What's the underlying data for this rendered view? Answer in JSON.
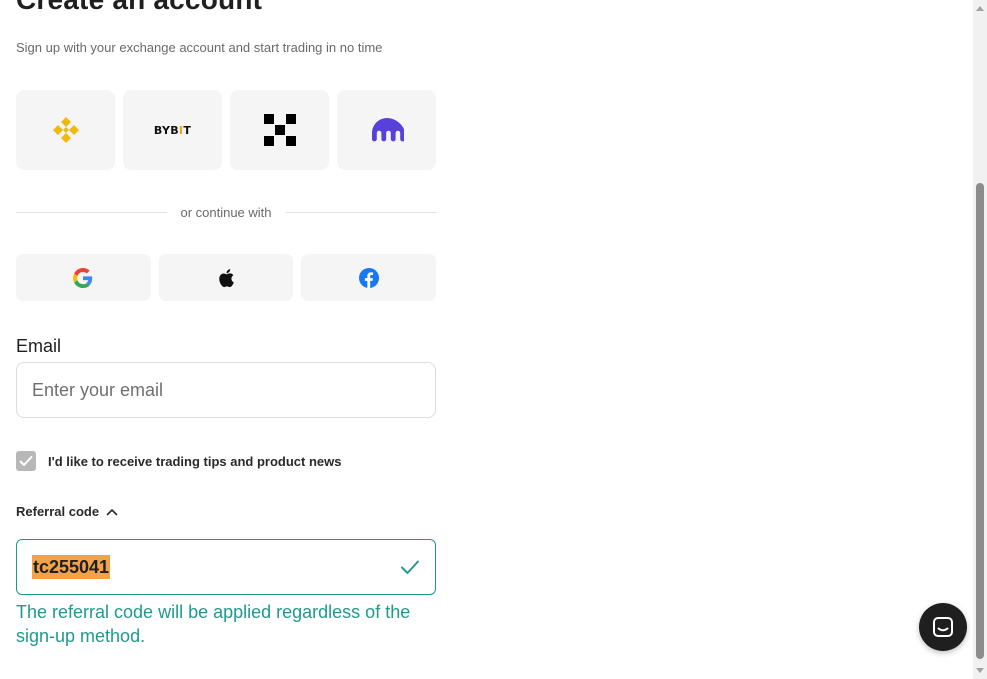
{
  "header": {
    "title": "Create an account",
    "subtitle": "Sign up with your exchange account and start trading in no time"
  },
  "exchanges": [
    {
      "name": "Binance",
      "icon": "binance-logo-icon"
    },
    {
      "name": "Bybit",
      "icon": "bybit-logo-icon",
      "logo_text_before": "BYB",
      "logo_text_accent": "I",
      "logo_text_after": "T"
    },
    {
      "name": "OKX",
      "icon": "okx-logo-icon"
    },
    {
      "name": "Kraken",
      "icon": "kraken-logo-icon"
    }
  ],
  "divider": {
    "text": "or continue with"
  },
  "social": [
    {
      "name": "Google",
      "icon": "google-icon"
    },
    {
      "name": "Apple",
      "icon": "apple-icon"
    },
    {
      "name": "Facebook",
      "icon": "facebook-icon"
    }
  ],
  "email": {
    "label": "Email",
    "placeholder": "Enter your email",
    "value": ""
  },
  "newsletter": {
    "label": "I'd like to receive trading tips and product news",
    "checked": true
  },
  "referral": {
    "toggle_label": "Referral code",
    "expanded": true,
    "value": "tc255041",
    "valid": true,
    "note": "The referral code will be applied regardless of the sign-up method."
  },
  "colors": {
    "accent_teal": "#1e9a8e",
    "highlight": "#f4a24a",
    "binance": "#f0b90b",
    "kraken": "#5741d9",
    "facebook": "#1877f2"
  },
  "chat_widget": {
    "icon": "chat-icon"
  }
}
